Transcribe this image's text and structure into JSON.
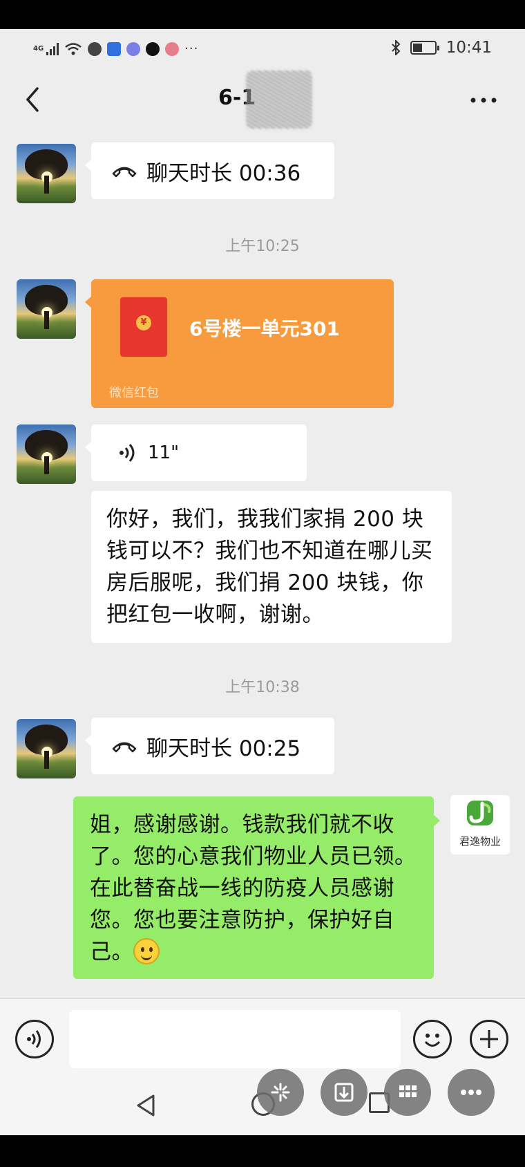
{
  "status_bar": {
    "network": "4G",
    "time": "10:41"
  },
  "header": {
    "title": "6-1",
    "back_icon": "chevron-left-icon",
    "more_icon": "ellipsis-icon"
  },
  "messages": {
    "call1": {
      "icon": "phone-hangup-icon",
      "text": "聊天时长 00:36"
    },
    "time1": "上午10:25",
    "red_packet": {
      "title": "6号楼一单元301",
      "footer": "微信红包",
      "seal": "¥"
    },
    "voice": {
      "icon": "voice-wave-icon",
      "duration": "11\""
    },
    "text1": "你好，我们，我我们家捐 200 块钱可以不？我们也不知道在哪儿买房后服呢，我们捐 200 块钱，你把红包一收啊，谢谢。",
    "time2": "上午10:38",
    "call2": {
      "icon": "phone-hangup-icon",
      "text": "聊天时长 00:25"
    },
    "reply": "姐，感谢感谢。钱款我们就不收了。您的心意我们物业人员已领。在此替奋战一线的防疫人员感谢您。您也要注意防护，保护好自己。",
    "reply_brand": "君逸物业"
  },
  "colors": {
    "chat_bg": "#ededed",
    "outgoing_bubble": "#95ec69",
    "red_packet": "#f89b3f"
  }
}
